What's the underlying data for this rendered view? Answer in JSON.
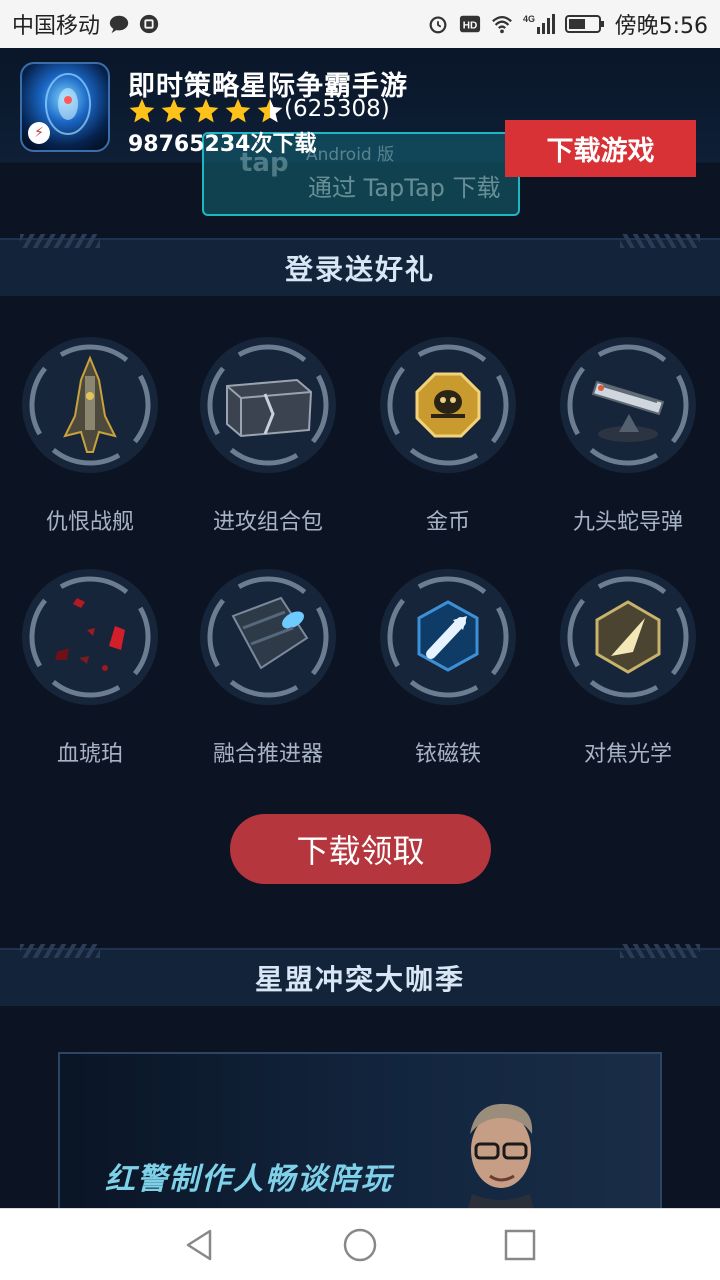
{
  "status_bar": {
    "carrier": "中国移动",
    "time": "傍晚5:56",
    "network": "4G"
  },
  "banner": {
    "app_title": "即时策略星际争霸手游",
    "rating_count": "(625308)",
    "downloads": "98765234次下载",
    "taptap_button": "通过 TapTap 下载",
    "android_tag": "Android 版",
    "tap_logo": "tap",
    "download_button": "下载游戏",
    "star_rating": 4.5
  },
  "login_gift": {
    "title": "登录送好礼",
    "items": [
      {
        "label": "仇恨战舰",
        "icon": "warship-icon"
      },
      {
        "label": "进攻组合包",
        "icon": "crate-icon"
      },
      {
        "label": "金币",
        "icon": "gold-coin-icon"
      },
      {
        "label": "九头蛇导弹",
        "icon": "missile-launcher-icon"
      },
      {
        "label": "血琥珀",
        "icon": "blood-amber-icon"
      },
      {
        "label": "融合推进器",
        "icon": "thruster-icon"
      },
      {
        "label": "铱磁铁",
        "icon": "magnet-icon"
      },
      {
        "label": "对焦光学",
        "icon": "optics-icon"
      }
    ],
    "claim_button": "下载领取"
  },
  "season": {
    "title": "星盟冲突大咖季",
    "video_caption": "红警制作人畅谈陪玩"
  },
  "colors": {
    "accent_red": "#d83237",
    "claim_red": "#b5363d",
    "background": "#0c1424",
    "header": "#132339"
  }
}
